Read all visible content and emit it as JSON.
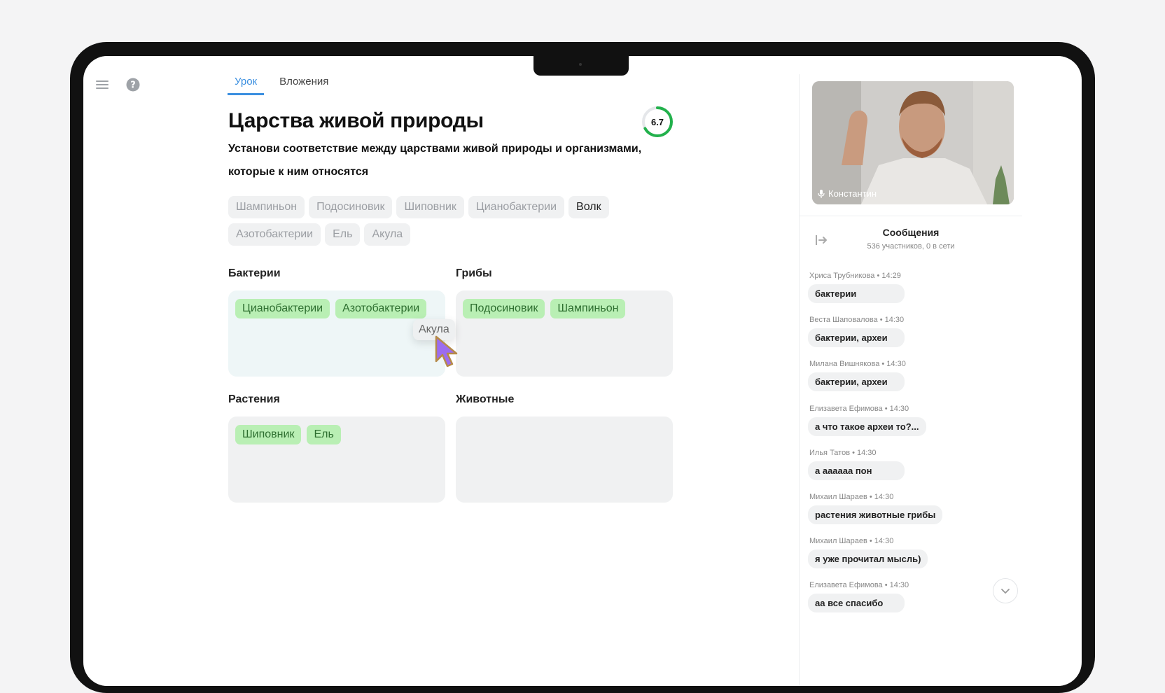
{
  "tabs": [
    {
      "label": "Урок",
      "active": true
    },
    {
      "label": "Вложения",
      "active": false
    }
  ],
  "lesson": {
    "title": "Царства живой природы",
    "score": "6.7",
    "score_fraction": 0.67,
    "instruction": "Установи соответствие между царствами живой природы и организмами, которые к ним относятся"
  },
  "bank": [
    {
      "label": "Шампиньон",
      "used": true
    },
    {
      "label": "Подосиновик",
      "used": true
    },
    {
      "label": "Шиповник",
      "used": true
    },
    {
      "label": "Цианобактерии",
      "used": true
    },
    {
      "label": "Волк",
      "used": false
    },
    {
      "label": "Азотобактерии",
      "used": true
    },
    {
      "label": "Ель",
      "used": true
    },
    {
      "label": "Акула",
      "used": true
    }
  ],
  "categories": [
    {
      "label": "Бактерии",
      "items": [
        "Цианобактерии",
        "Азотобактерии"
      ]
    },
    {
      "label": "Грибы",
      "items": [
        "Подосиновик",
        "Шампиньон"
      ]
    },
    {
      "label": "Растения",
      "items": [
        "Шиповник",
        "Ель"
      ]
    },
    {
      "label": "Животные",
      "items": []
    }
  ],
  "dragging": "Акула",
  "video": {
    "name": "Константин"
  },
  "chat": {
    "title": "Сообщения",
    "subtitle": "536 участников, 0 в сети",
    "messages": [
      {
        "meta": "Хриса Трубникова • 14:29",
        "text": "бактерии"
      },
      {
        "meta": "Веста Шаповалова • 14:30",
        "text": "бактерии, археи"
      },
      {
        "meta": "Милана Вишнякова • 14:30",
        "text": "бактерии, археи"
      },
      {
        "meta": "Елизавета Ефимова • 14:30",
        "text": "а что такое археи то?..."
      },
      {
        "meta": "Илья Татов • 14:30",
        "text": "а аааааа пон"
      },
      {
        "meta": "Михаил Шараев • 14:30",
        "text": "растения животные грибы"
      },
      {
        "meta": "Михаил Шараев • 14:30",
        "text": "я уже прочитал мысль)"
      },
      {
        "meta": "Елизавета Ефимова • 14:30",
        "text": "аа все спасибо"
      }
    ]
  },
  "colors": {
    "accent": "#3b8fe0",
    "correct": "#b9efb4",
    "progress": "#22b14c"
  }
}
